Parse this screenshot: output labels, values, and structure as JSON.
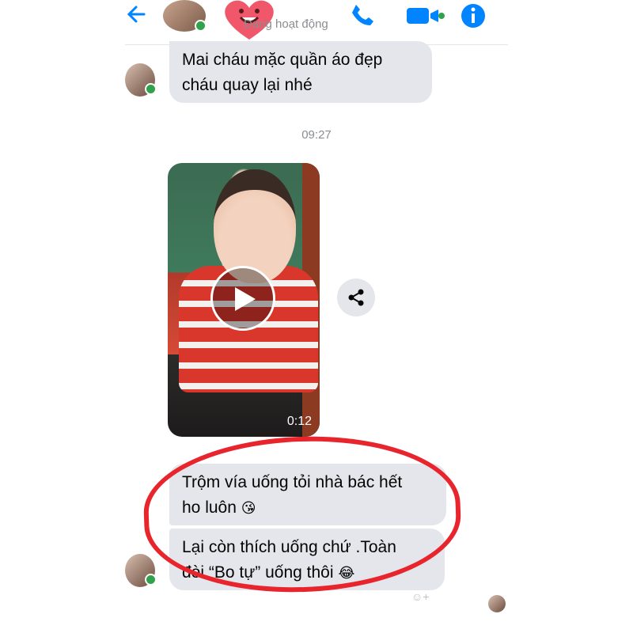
{
  "header": {
    "status": "Đang hoạt động",
    "icons": [
      "back-arrow-icon",
      "phone-icon",
      "video-camera-icon",
      "info-icon",
      "heart-face-sticker-icon"
    ]
  },
  "messages": [
    {
      "text_line1": "Mai cháu mặc quần áo đẹp",
      "text_line2": "cháu quay lại nhé"
    }
  ],
  "timestamp": "09:27",
  "video": {
    "duration": "0:12"
  },
  "message2": {
    "line1": "Trộm vía uống tỏi nhà bác hết",
    "line2": "ho luôn",
    "emoji": "😘"
  },
  "message3": {
    "line1": "Lại còn thích uống chứ .Toàn",
    "line2": "đòi “Bo tự” uống thôi",
    "emoji": "😂"
  },
  "reaction": "☺+",
  "colors": {
    "accent": "#0084ff",
    "bubble": "#e4e6eb",
    "online": "#31a24c",
    "highlight_circle": "#e8242c"
  }
}
